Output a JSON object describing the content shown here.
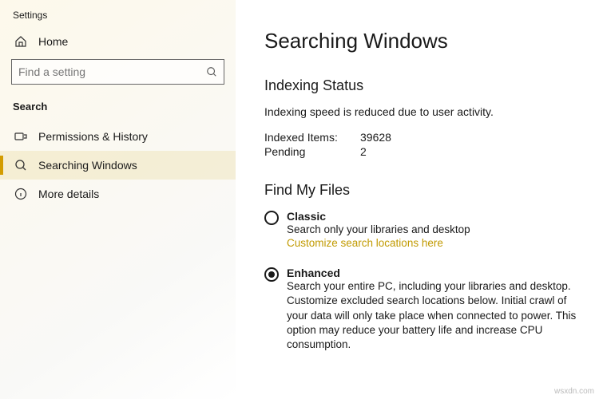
{
  "app_title": "Settings",
  "sidebar": {
    "home_label": "Home",
    "search_placeholder": "Find a setting",
    "section_label": "Search",
    "items": [
      {
        "label": "Permissions & History"
      },
      {
        "label": "Searching Windows"
      },
      {
        "label": "More details"
      }
    ]
  },
  "page": {
    "title": "Searching Windows",
    "indexing": {
      "heading": "Indexing Status",
      "status": "Indexing speed is reduced due to user activity.",
      "indexed_label": "Indexed Items:",
      "indexed_value": "39628",
      "pending_label": "Pending",
      "pending_value": "2"
    },
    "find": {
      "heading": "Find My Files",
      "classic": {
        "title": "Classic",
        "desc": "Search only your libraries and desktop",
        "link": "Customize search locations here"
      },
      "enhanced": {
        "title": "Enhanced",
        "desc": "Search your entire PC, including your libraries and desktop. Customize excluded search locations below. Initial crawl of your data will only take place when connected to power. This option may reduce your battery life and increase CPU consumption."
      }
    }
  },
  "watermark": "wsxdn.com"
}
